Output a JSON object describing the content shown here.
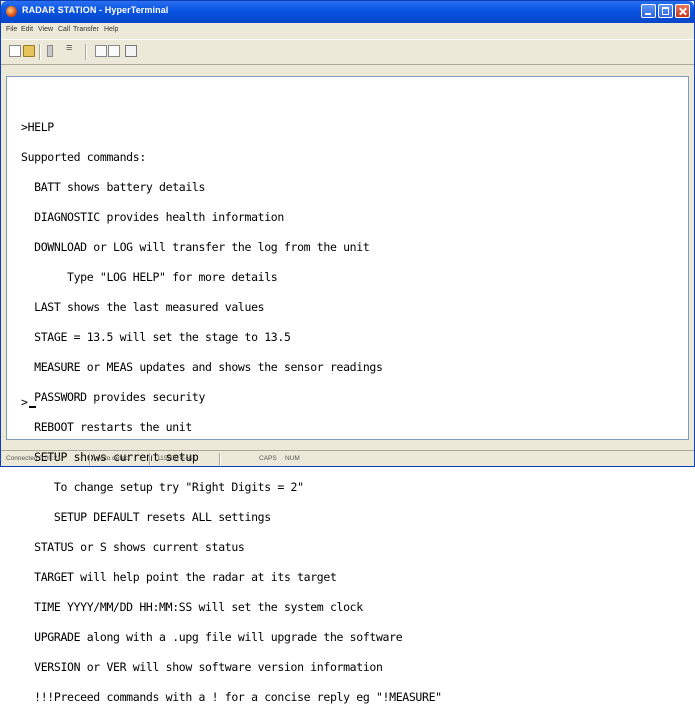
{
  "window": {
    "title": "RADAR STATION - HyperTerminal"
  },
  "menu": {
    "items": [
      "File",
      "Edit",
      "View",
      "Call",
      "Transfer",
      "Help"
    ]
  },
  "toolbar": {
    "icons": [
      "new-icon",
      "open-icon",
      "disconnect-icon",
      "call-icon",
      "send-icon",
      "receive-icon",
      "properties-icon"
    ]
  },
  "terminal": {
    "lines": [
      ">HELP",
      "Supported commands:",
      "  BATT shows battery details",
      "  DIAGNOSTIC provides health information",
      "  DOWNLOAD or LOG will transfer the log from the unit",
      "       Type \"LOG HELP\" for more details",
      "  LAST shows the last measured values",
      "  STAGE = 13.5 will set the stage to 13.5",
      "  MEASURE or MEAS updates and shows the sensor readings",
      "  PASSWORD provides security",
      "  REBOOT restarts the unit",
      "  SETUP shows current setup",
      "     To change setup try \"Right Digits = 2\"",
      "     SETUP DEFAULT resets ALL settings",
      "  STATUS or S shows current status",
      "  TARGET will help point the radar at its target",
      "  TIME YYYY/MM/DD HH:MM:SS will set the system clock",
      "  UPGRADE along with a .upg file will upgrade the software",
      "  VERSION or VER will show software version information",
      "  !!!Preceed commands with a ! for a concise reply eg \"!MEASURE\""
    ],
    "prompt": ">"
  },
  "status": {
    "connected": "Connected 0:00:21",
    "detect": "Auto detect",
    "settings": "115200 8-N-1",
    "caps": "CAPS",
    "num": "NUM"
  },
  "colors": {
    "titlebar": "#0a55e3",
    "chrome": "#ece9d8",
    "terminal_bg": "#ffffff",
    "terminal_text": "#000000",
    "close_button": "#c2381c"
  }
}
